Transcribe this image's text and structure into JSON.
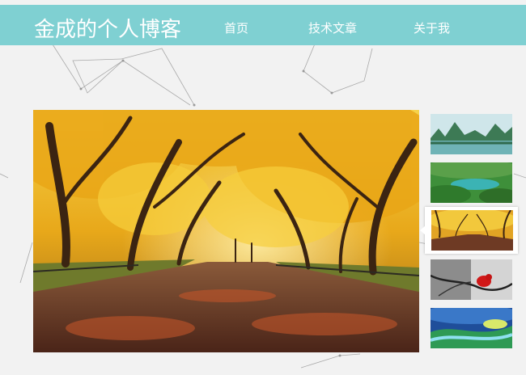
{
  "header": {
    "site_title": "金成的个人博客",
    "nav": [
      "首页",
      "技术文章",
      "关于我"
    ]
  },
  "gallery": {
    "main_image": "autumn-tree-avenue",
    "thumbnails": [
      {
        "image": "karst-river-landscape",
        "active": false
      },
      {
        "image": "green-lake-mountains",
        "active": false
      },
      {
        "image": "autumn-tree-avenue",
        "active": true
      },
      {
        "image": "red-bird-on-snowy-branch",
        "active": false
      },
      {
        "image": "blue-river-painting",
        "active": false
      }
    ]
  },
  "colors": {
    "header_bg": "#7fd0d2",
    "page_bg": "#f2f2f2",
    "nav_text": "#ffffff"
  }
}
